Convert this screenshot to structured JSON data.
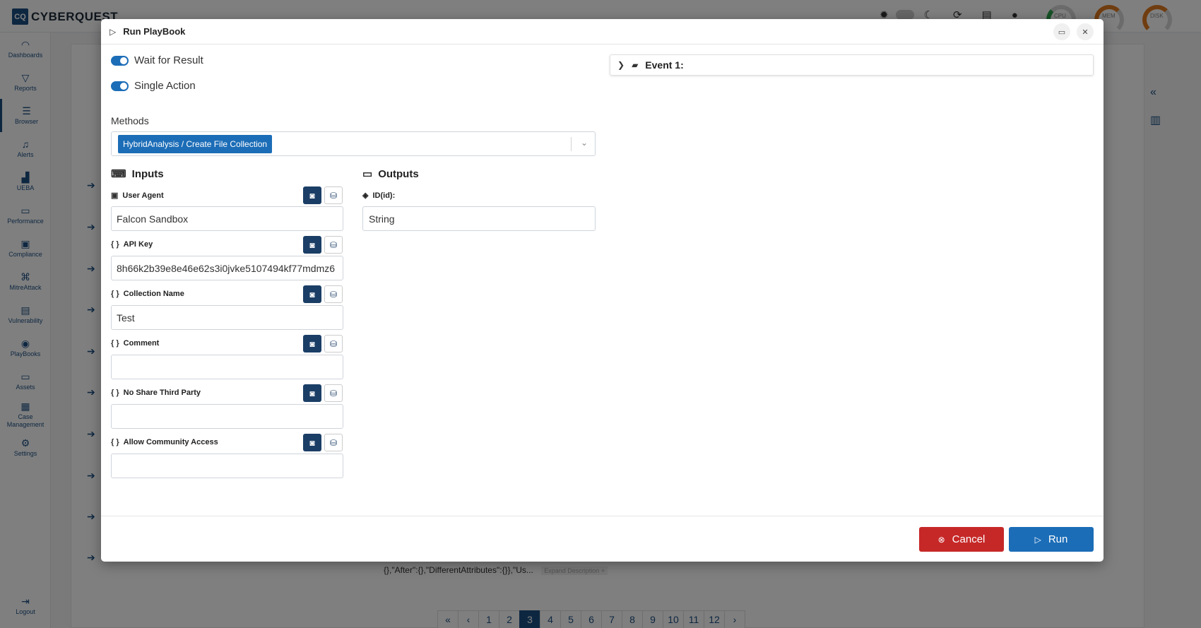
{
  "app": {
    "logo_mark": "CQ",
    "brand": "CYBERQUEST",
    "gauges": [
      {
        "label": "CPU",
        "color": "#2ea44f"
      },
      {
        "label": "MEM",
        "color": "#e07a20"
      },
      {
        "label": "DISK",
        "color": "#e07a20"
      }
    ],
    "gauge_scale": [
      "0",
      "100"
    ]
  },
  "topbar_icons": [
    "settings-sun-icon",
    "theme-toggle",
    "moon-icon",
    "refresh-icon",
    "calendar-icon",
    "user-icon"
  ],
  "sidebar": {
    "items": [
      {
        "label": "Dashboards",
        "icon": "dashboard-icon"
      },
      {
        "label": "Reports",
        "icon": "filter-icon"
      },
      {
        "label": "Browser",
        "icon": "list-icon",
        "active": true
      },
      {
        "label": "Alerts",
        "icon": "bell-icon"
      },
      {
        "label": "UEBA",
        "icon": "chart-icon"
      },
      {
        "label": "Performance",
        "icon": "keyboard-icon"
      },
      {
        "label": "Compliance",
        "icon": "compliance-icon"
      },
      {
        "label": "MitreAttack",
        "icon": "command-icon"
      },
      {
        "label": "Vulnerability",
        "icon": "server-icon"
      },
      {
        "label": "PlayBooks",
        "icon": "playbook-icon"
      },
      {
        "label": "Assets",
        "icon": "laptop-icon"
      },
      {
        "label": "Case Management",
        "icon": "briefcase-icon"
      },
      {
        "label": "Settings",
        "icon": "gear-icon"
      }
    ],
    "logout": "Logout"
  },
  "background": {
    "snippet": "{},\"After\":{},\"DifferentAttributes\":{}},\"Us...",
    "expand_label": "Expand Description",
    "expand_symbol": "+"
  },
  "pagination": {
    "prev_all": "«",
    "prev": "‹",
    "pages": [
      "1",
      "2",
      "3",
      "4",
      "5",
      "6",
      "7",
      "8",
      "9",
      "10",
      "11",
      "12"
    ],
    "current": "3",
    "next": "›"
  },
  "modal": {
    "title": "Run PlayBook",
    "toggles": {
      "wait_for_result": "Wait for Result",
      "single_action": "Single Action"
    },
    "methods": {
      "label": "Methods",
      "selected": "HybridAnalysis / Create File Collection"
    },
    "inputs": {
      "heading": "Inputs",
      "fields": [
        {
          "label": "User Agent",
          "value": "Falcon Sandbox"
        },
        {
          "label": "API Key",
          "value": "8h66k2b39e8e46e62s3i0jvke5107494kf77mdmz6"
        },
        {
          "label": "Collection Name",
          "value": "Test"
        },
        {
          "label": "Comment",
          "value": ""
        },
        {
          "label": "No Share Third Party",
          "value": ""
        },
        {
          "label": "Allow Community Access",
          "value": ""
        }
      ]
    },
    "outputs": {
      "heading": "Outputs",
      "fields": [
        {
          "label": "ID(id):",
          "value": "String"
        }
      ]
    },
    "event": {
      "title": "Event 1:"
    },
    "buttons": {
      "cancel": "Cancel",
      "run": "Run"
    }
  }
}
